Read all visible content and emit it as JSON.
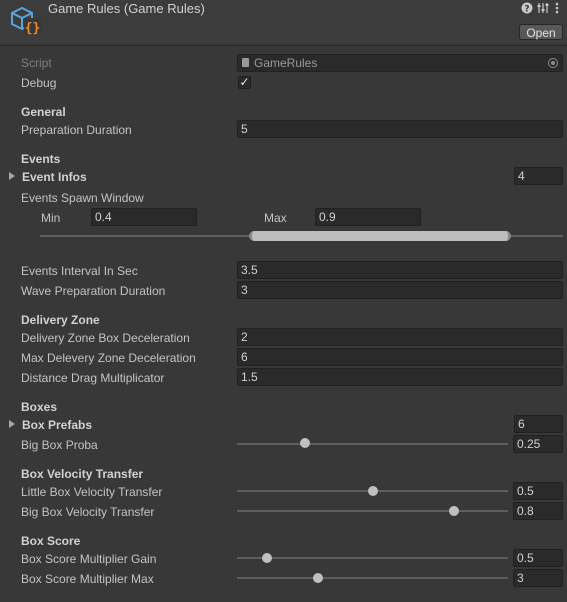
{
  "header": {
    "title": "Game Rules (Game Rules)",
    "help_icon": "help-icon",
    "settings_icon": "presets-icon",
    "menu_icon": "more-menu-icon",
    "open_label": "Open"
  },
  "script": {
    "label": "Script",
    "value": "GameRules"
  },
  "debug": {
    "label": "Debug",
    "checked": true,
    "check_mark": "✓"
  },
  "general": {
    "title": "General",
    "preparation_duration": {
      "label": "Preparation Duration",
      "value": "5"
    }
  },
  "events": {
    "title": "Events",
    "event_infos": {
      "label": "Event Infos",
      "count": "4"
    },
    "spawn_window": {
      "label": "Events Spawn Window",
      "min_label": "Min",
      "min": "0.4",
      "max_label": "Max",
      "max": "0.9",
      "range_min": 0.4,
      "range_max": 0.9
    },
    "interval": {
      "label": "Events Interval In Sec",
      "value": "3.5"
    },
    "wave_preparation": {
      "label": "Wave Preparation Duration",
      "value": "3"
    }
  },
  "delivery_zone": {
    "title": "Delivery Zone",
    "box_deceleration": {
      "label": "Delivery Zone Box Deceleration",
      "value": "2"
    },
    "max_deceleration": {
      "label": "Max Delevery Zone Deceleration",
      "value": "6"
    },
    "drag_multiplicator": {
      "label": "Distance Drag Multiplicator",
      "value": "1.5"
    }
  },
  "boxes": {
    "title": "Boxes",
    "box_prefabs": {
      "label": "Box Prefabs",
      "count": "6"
    },
    "big_box_proba": {
      "label": "Big Box Proba",
      "value": "0.25",
      "fraction": 0.25
    }
  },
  "velocity_transfer": {
    "title": "Box Velocity Transfer",
    "little": {
      "label": "Little Box Velocity Transfer",
      "value": "0.5",
      "fraction": 0.5
    },
    "big": {
      "label": "Big Box Velocity Transfer",
      "value": "0.8",
      "fraction": 0.8
    }
  },
  "box_score": {
    "title": "Box Score",
    "gain": {
      "label": "Box Score Multiplier Gain",
      "value": "0.5",
      "fraction": 0.11
    },
    "max": {
      "label": "Box Score Multiplier Max",
      "value": "3",
      "fraction": 0.3
    }
  }
}
